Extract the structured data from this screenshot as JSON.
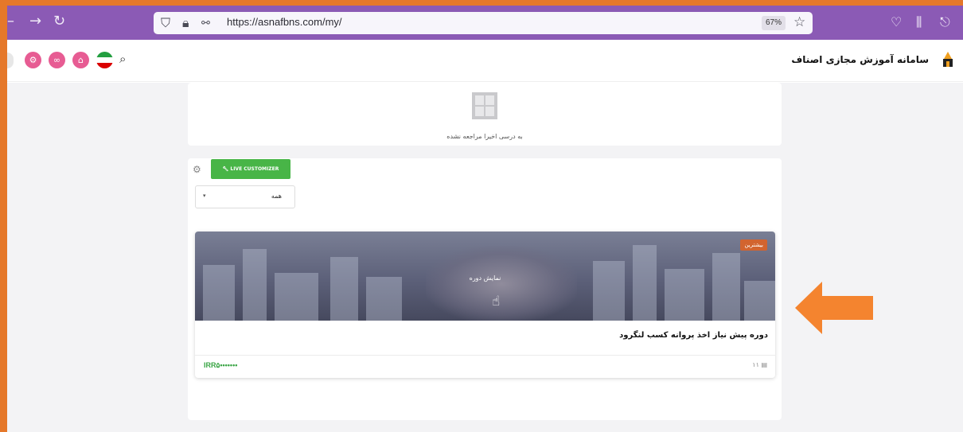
{
  "browser": {
    "url": "https://asnafbns.com/my/",
    "zoom": "67%"
  },
  "site": {
    "title": "سامانه آموزش مجازی اصناف"
  },
  "recent": {
    "empty_text": "به درسی اخیرا مراجعه نشده"
  },
  "toolbar": {
    "live_customizer_label": "LIVE CUSTOMIZER"
  },
  "filter": {
    "selected": "همه"
  },
  "course": {
    "badge": "بیشترین",
    "view_label": "نمایش دوره",
    "title": "دوره پیش نیاز اخذ پروانه کسب لنگرود",
    "price": "IRR۵•••••••",
    "lessons_count": "۱۱"
  },
  "colors": {
    "browser_accent": "#8b5ab5",
    "frame": "#e5782a",
    "pink_buttons": "#e75c93",
    "green_button": "#48b547",
    "badge": "#d2642f",
    "price": "#3aa545"
  }
}
